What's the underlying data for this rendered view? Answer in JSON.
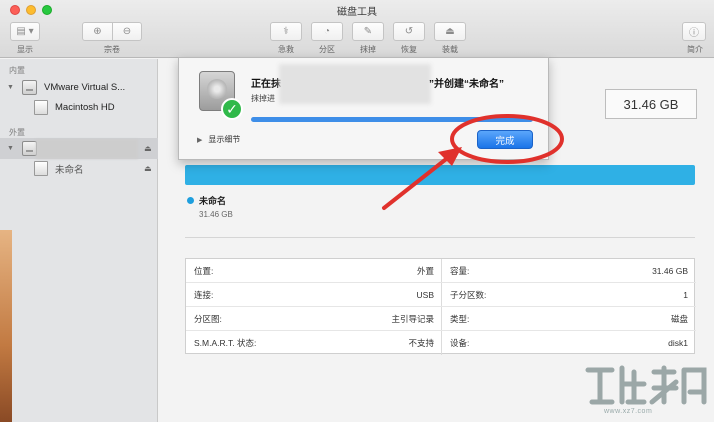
{
  "window": {
    "title": "磁盘工具"
  },
  "toolbar": {
    "display_label": "显示",
    "volume_label": "宗卷",
    "rescue_label": "急救",
    "partition_label": "分区",
    "erase_label": "抹掉",
    "restore_label": "恢复",
    "mount_label": "装载",
    "info_label": "简介"
  },
  "sidebar": {
    "internal_section": "内置",
    "external_section": "外置",
    "internal_disk": "VMware Virtual S...",
    "internal_volume": "Macintosh HD",
    "external_volume": "未命名"
  },
  "sheet": {
    "title_start": "正在抹",
    "title_end": "”并创建“未命名”",
    "subtitle": "抹掉进",
    "progress": 1.0,
    "show_details": "显示细节",
    "done_button": "完成"
  },
  "main": {
    "capacity": "31.46 GB",
    "legend_name": "未命名",
    "legend_size": "31.46 GB",
    "bar_color": "#2fb0e5"
  },
  "info": [
    {
      "left_label": "位置:",
      "left_value": "外置",
      "right_label": "容量:",
      "right_value": "31.46 GB"
    },
    {
      "left_label": "连接:",
      "left_value": "USB",
      "right_label": "子分区数:",
      "right_value": "1"
    },
    {
      "left_label": "分区图:",
      "left_value": "主引导记录",
      "right_label": "类型:",
      "right_value": "磁盘"
    },
    {
      "left_label": "S.M.A.R.T. 状态:",
      "left_value": "不支持",
      "right_label": "设备:",
      "right_value": "disk1"
    }
  ],
  "watermark": {
    "text": "www.xz7.com"
  },
  "colors": {
    "accent": "#1a74e8",
    "annotation": "#e0312c",
    "check": "#30b94a"
  }
}
